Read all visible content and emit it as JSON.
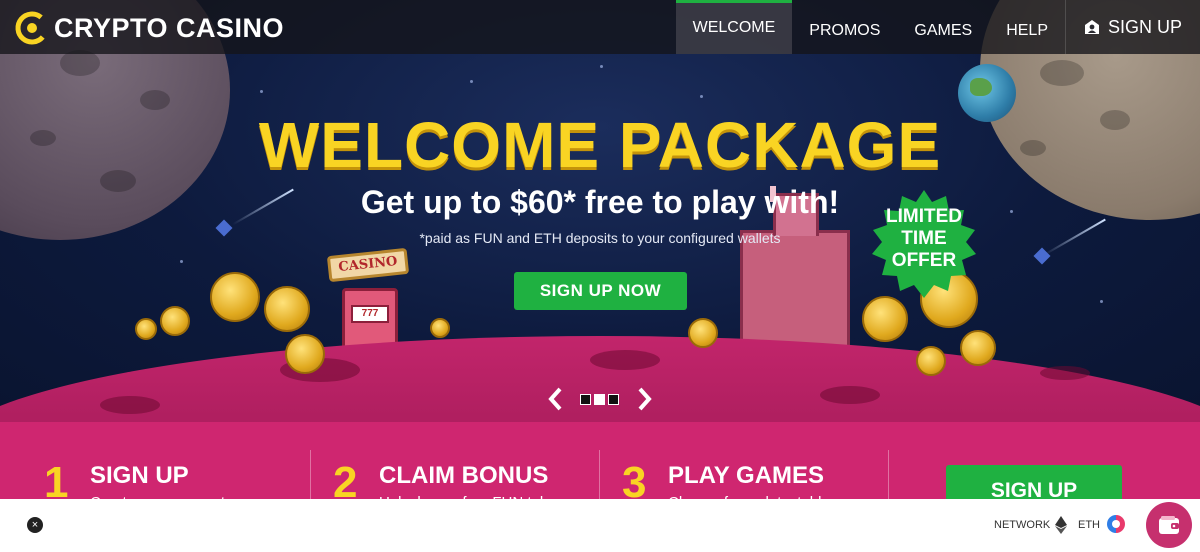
{
  "brand": {
    "name": "CRYPTO CASINO"
  },
  "nav": {
    "items": [
      {
        "label": "WELCOME",
        "active": true
      },
      {
        "label": "PROMOS",
        "active": false
      },
      {
        "label": "GAMES",
        "active": false
      },
      {
        "label": "HELP",
        "active": false
      }
    ],
    "signup_label": "SIGN UP",
    "signup_icon": "user-icon"
  },
  "hero": {
    "headline": "WELCOME PACKAGE",
    "subhead": "Get up to $60* free to play with!",
    "note": "*paid as FUN and ETH deposits to your configured wallets",
    "cta_label": "SIGN UP NOW",
    "badge_lines": [
      "LIMITED",
      "TIME",
      "OFFER"
    ],
    "casino_sign": "CASINO",
    "slot_reels": "777",
    "carousel": {
      "slides": 3,
      "active_slide": 2
    }
  },
  "steps": [
    {
      "number": "1",
      "title": "SIGN UP",
      "desc": "Create your account"
    },
    {
      "number": "2",
      "title": "CLAIM BONUS",
      "desc": "Unlock your free FUN tokens"
    },
    {
      "number": "3",
      "title": "PLAY GAMES",
      "desc": "Choose from slots, table"
    }
  ],
  "band_cta_label": "SIGN UP",
  "bottom_bar": {
    "close_symbol": "×",
    "network_label": "NETWORK",
    "currency_label": "ETH",
    "network_icon": "ethereum-icon",
    "status_icon": "sync-icon",
    "wallet_icon": "wallet-icon"
  },
  "colors": {
    "accent_green": "#1fb141",
    "headline_yellow": "#f9d423",
    "band_pink": "#cf2670"
  }
}
